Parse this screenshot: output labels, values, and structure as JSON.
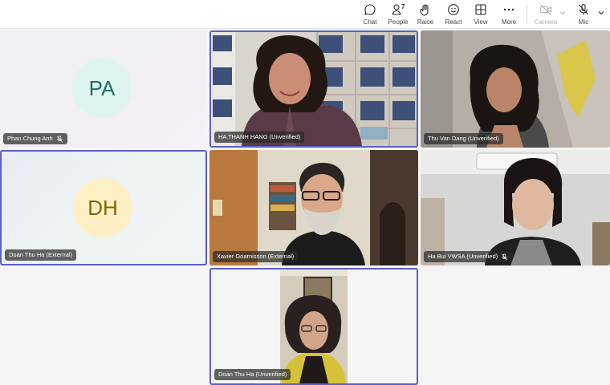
{
  "toolbar": {
    "chat": "Chat",
    "people": "People",
    "people_count": "7",
    "raise": "Raise",
    "react": "React",
    "view": "View",
    "more": "More",
    "camera": "Camera",
    "mic": "Mic"
  },
  "participants": [
    {
      "name": "Phan Chung Anh",
      "initials": "PA",
      "muted": true
    },
    {
      "name": "HA THANH HANG (Unverified)",
      "muted": false
    },
    {
      "name": "Thu Van Dang (Unverified)",
      "muted": false
    },
    {
      "name": "Doan Thu Ha (External)",
      "initials": "DH",
      "muted": false
    },
    {
      "name": "Xavier Goarnisson (External)",
      "muted": false
    },
    {
      "name": "Ha Bui VWSA (Unverified)",
      "muted": true
    },
    {
      "name": "Doan Thu Ha (Unverified)",
      "muted": false
    }
  ],
  "colors": {
    "accent": "#5b5fc7",
    "avatar_pa_bg": "#dff3f1",
    "avatar_pa_fg": "#1f6f68",
    "avatar_dh_bg": "#fdf0c4",
    "avatar_dh_fg": "#8a6200"
  }
}
